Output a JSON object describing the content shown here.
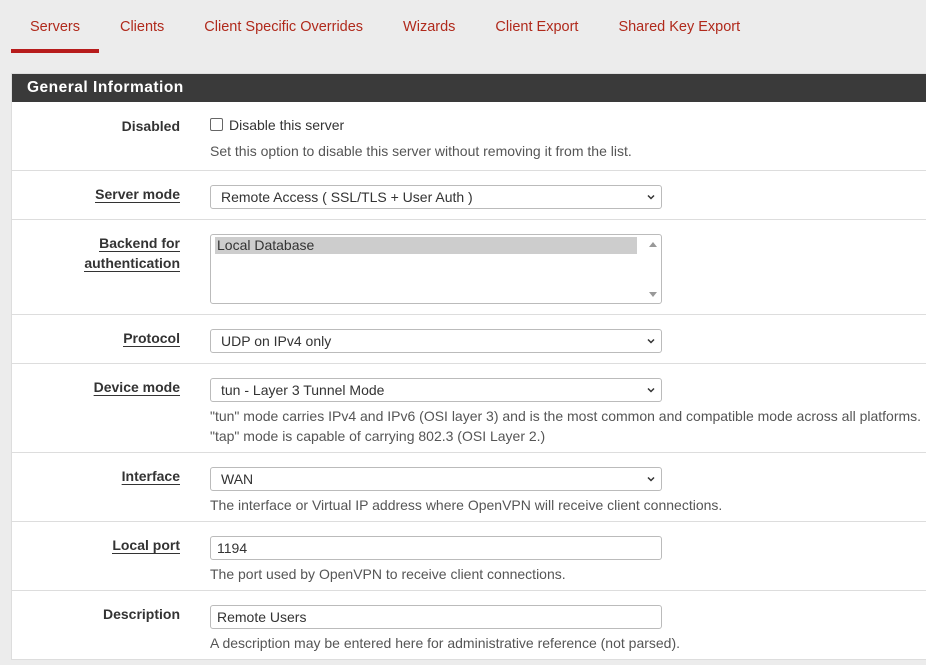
{
  "tabs": [
    "Servers",
    "Clients",
    "Client Specific Overrides",
    "Wizards",
    "Client Export",
    "Shared Key Export"
  ],
  "panel_title": "General Information",
  "disabled": {
    "label": "Disabled",
    "checkbox_label": "Disable this server",
    "help": "Set this option to disable this server without removing it from the list."
  },
  "server_mode": {
    "label": "Server mode",
    "value": "Remote Access ( SSL/TLS + User Auth )"
  },
  "backend": {
    "label_line1": "Backend for",
    "label_line2": "authentication",
    "options": [
      "Local Database"
    ]
  },
  "protocol": {
    "label": "Protocol",
    "value": "UDP on IPv4 only"
  },
  "device_mode": {
    "label": "Device mode",
    "value": "tun - Layer 3 Tunnel Mode",
    "help1": "\"tun\" mode carries IPv4 and IPv6 (OSI layer 3) and is the most common and compatible mode across all platforms.",
    "help2": "\"tap\" mode is capable of carrying 802.3 (OSI Layer 2.)"
  },
  "interface": {
    "label": "Interface",
    "value": "WAN",
    "help": "The interface or Virtual IP address where OpenVPN will receive client connections."
  },
  "local_port": {
    "label": "Local port",
    "value": "1194",
    "help": "The port used by OpenVPN to receive client connections."
  },
  "description": {
    "label": "Description",
    "value": "Remote Users",
    "help": "A description may be entered here for administrative reference (not parsed)."
  },
  "colors": {
    "accent": "#b71c1c",
    "tab_text": "#b0291b",
    "heading_bg": "#3a3a3a"
  }
}
